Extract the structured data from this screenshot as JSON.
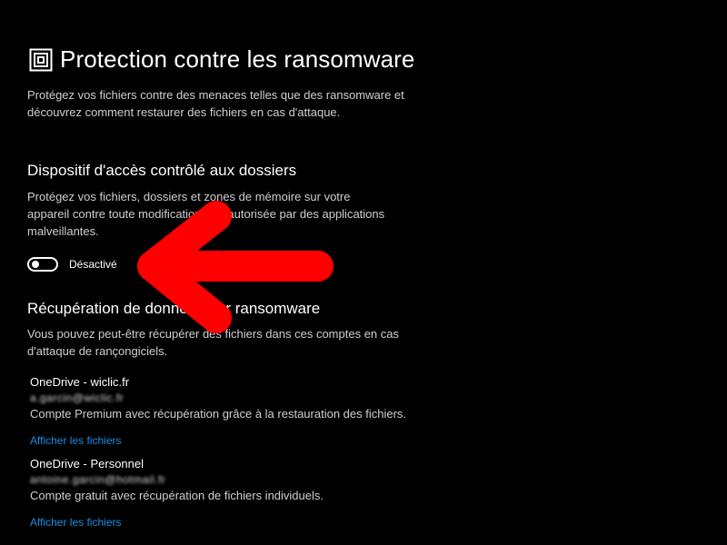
{
  "page": {
    "title": "Protection contre les ransomware",
    "title_icon": "ransomware-shield-icon",
    "description": "Protégez vos fichiers contre des menaces telles que des ransomware et découvrez comment restaurer des fichiers en cas d'attaque."
  },
  "controlled_folder_access": {
    "heading": "Dispositif d'accès contrôlé aux dossiers",
    "description": "Protégez vos fichiers, dossiers et zones de mémoire sur votre appareil contre toute modification non autorisée par des applications malveillantes.",
    "toggle_state": "off",
    "toggle_label": "Désactivé"
  },
  "recovery": {
    "heading": "Récupération de données par ransomware",
    "description": "Vous pouvez peut-être récupérer des fichiers dans ces comptes en cas d'attaque de rançongiciels.",
    "accounts": [
      {
        "name": "OneDrive - wiclic.fr",
        "email": "a.garcin@wiclic.fr",
        "info": "Compte Premium avec récupération grâce à la restauration des fichiers.",
        "link": "Afficher les fichiers"
      },
      {
        "name": "OneDrive - Personnel",
        "email": "antoine.garcin@hotmail.fr",
        "info": "Compte gratuit avec récupération de fichiers individuels.",
        "link": "Afficher les fichiers"
      }
    ]
  },
  "overlay": {
    "annotation": "red-arrow-icon",
    "color": "#ff0000"
  },
  "colors": {
    "background": "#000000",
    "link": "#1a8ee8",
    "text_secondary": "#cfcfcf"
  }
}
